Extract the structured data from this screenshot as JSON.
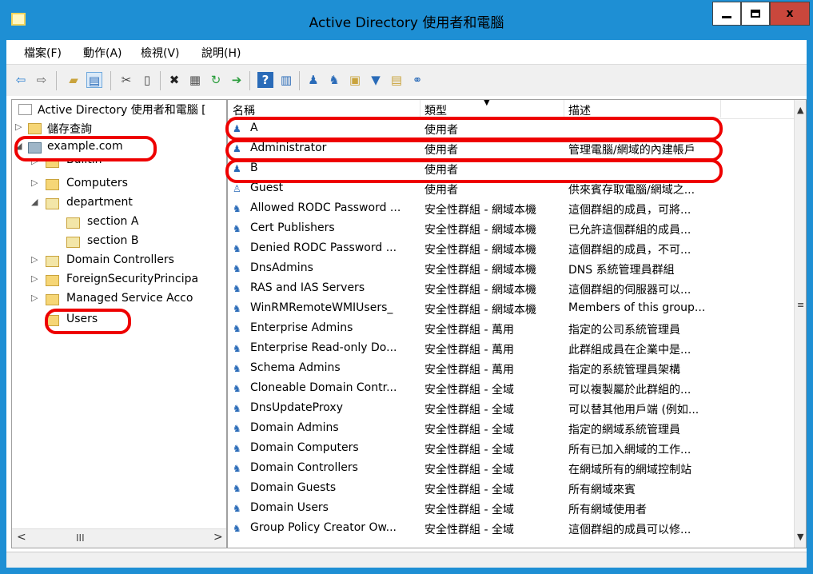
{
  "window": {
    "title": "Active Directory 使用者和電腦",
    "close_glyph": "x"
  },
  "menu": [
    "檔案(F)",
    "動作(A)",
    "檢視(V)",
    "說明(H)"
  ],
  "toolbar": {
    "icons": [
      "back-arrow-icon",
      "forward-arrow-icon",
      "folder-up-icon",
      "console-tree-icon",
      "cut-icon",
      "copy-icon",
      "delete-icon",
      "properties-icon",
      "refresh-icon",
      "export-icon",
      "help-icon",
      "details-icon",
      "new-user-icon",
      "new-group-icon",
      "new-ou-icon",
      "filter-icon",
      "find-icon",
      "add-to-group-icon"
    ]
  },
  "tree": {
    "root": "Active Directory 使用者和電腦 [",
    "saved_queries": "儲存查詢",
    "domain": "example.com",
    "builtin": "Builtin",
    "computers": "Computers",
    "department": "department",
    "section_a": "section A",
    "section_b": "section B",
    "domain_controllers": "Domain Controllers",
    "foreign_security": "ForeignSecurityPrincipa",
    "managed_service": "Managed Service Acco",
    "users": "Users",
    "hscroll_thumb": "III"
  },
  "list": {
    "columns": {
      "name": "名稱",
      "type": "類型",
      "desc": "描述"
    },
    "rows": [
      {
        "name": "A",
        "type": "使用者",
        "desc": "",
        "kind": "user"
      },
      {
        "name": "Administrator",
        "type": "使用者",
        "desc": "管理電腦/網域的內建帳戶",
        "kind": "user"
      },
      {
        "name": "B",
        "type": "使用者",
        "desc": "",
        "kind": "user"
      },
      {
        "name": "Guest",
        "type": "使用者",
        "desc": "供來賓存取電腦/網域之...",
        "kind": "user-disabled"
      },
      {
        "name": "Allowed RODC Password ...",
        "type": "安全性群組 - 網域本機",
        "desc": "這個群組的成員，可將...",
        "kind": "group"
      },
      {
        "name": "Cert Publishers",
        "type": "安全性群組 - 網域本機",
        "desc": "已允許這個群組的成員...",
        "kind": "group"
      },
      {
        "name": "Denied RODC Password ...",
        "type": "安全性群組 - 網域本機",
        "desc": "這個群組的成員，不可...",
        "kind": "group"
      },
      {
        "name": "DnsAdmins",
        "type": "安全性群組 - 網域本機",
        "desc": "DNS 系統管理員群組",
        "kind": "group"
      },
      {
        "name": "RAS and IAS Servers",
        "type": "安全性群組 - 網域本機",
        "desc": "這個群組的伺服器可以...",
        "kind": "group"
      },
      {
        "name": "WinRMRemoteWMIUsers_",
        "type": "安全性群組 - 網域本機",
        "desc": "Members of this group...",
        "kind": "group"
      },
      {
        "name": "Enterprise Admins",
        "type": "安全性群組 - 萬用",
        "desc": "指定的公司系統管理員",
        "kind": "group"
      },
      {
        "name": "Enterprise Read-only Do...",
        "type": "安全性群組 - 萬用",
        "desc": "此群組成員在企業中是...",
        "kind": "group"
      },
      {
        "name": "Schema Admins",
        "type": "安全性群組 - 萬用",
        "desc": "指定的系統管理員架構",
        "kind": "group"
      },
      {
        "name": "Cloneable Domain Contr...",
        "type": "安全性群組 - 全域",
        "desc": "可以複製屬於此群組的...",
        "kind": "group"
      },
      {
        "name": "DnsUpdateProxy",
        "type": "安全性群組 - 全域",
        "desc": "可以替其他用戶端 (例如...",
        "kind": "group"
      },
      {
        "name": "Domain Admins",
        "type": "安全性群組 - 全域",
        "desc": "指定的網域系統管理員",
        "kind": "group"
      },
      {
        "name": "Domain Computers",
        "type": "安全性群組 - 全域",
        "desc": "所有已加入網域的工作...",
        "kind": "group"
      },
      {
        "name": "Domain Controllers",
        "type": "安全性群組 - 全域",
        "desc": "在網域所有的網域控制站",
        "kind": "group"
      },
      {
        "name": "Domain Guests",
        "type": "安全性群組 - 全域",
        "desc": "所有網域來賓",
        "kind": "group"
      },
      {
        "name": "Domain Users",
        "type": "安全性群組 - 全域",
        "desc": "所有網域使用者",
        "kind": "group"
      },
      {
        "name": "Group Policy Creator Ow...",
        "type": "安全性群組 - 全域",
        "desc": "這個群組的成員可以修...",
        "kind": "group"
      }
    ]
  },
  "colors": {
    "titlebar": "#1e8fd4",
    "highlight_ring": "#e00000",
    "close_button": "#c9473c"
  }
}
